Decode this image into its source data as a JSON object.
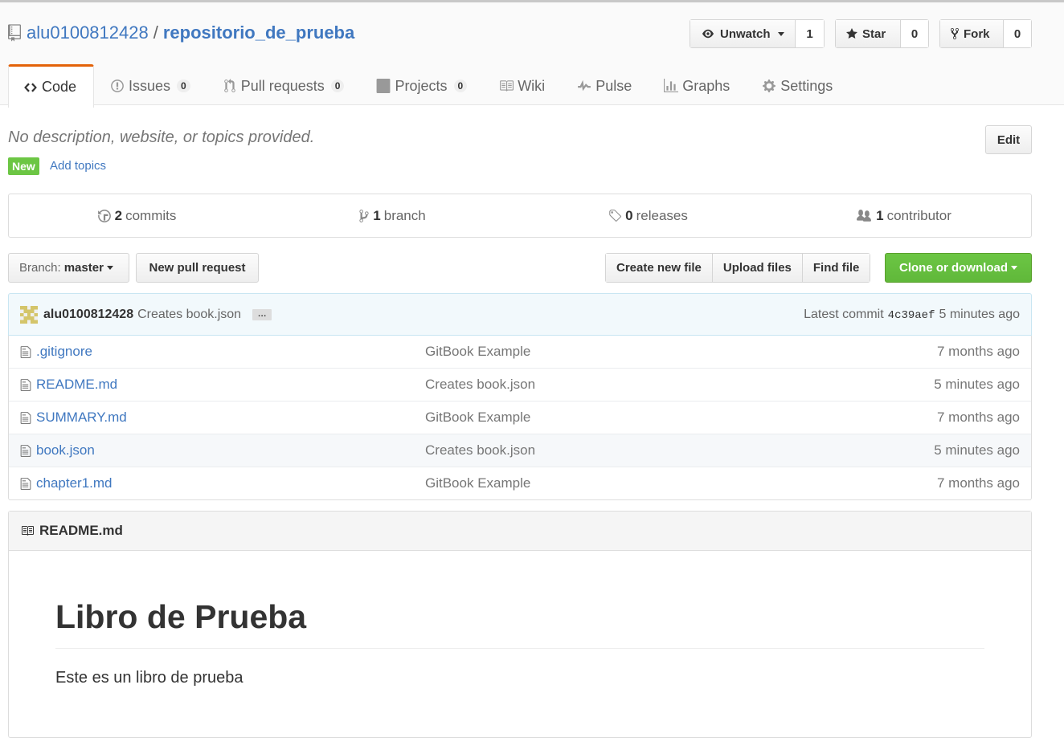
{
  "repo": {
    "owner": "alu0100812428",
    "separator": "/",
    "name": "repositorio_de_prueba"
  },
  "actions": {
    "watch": {
      "label": "Unwatch",
      "count": "1"
    },
    "star": {
      "label": "Star",
      "count": "0"
    },
    "fork": {
      "label": "Fork",
      "count": "0"
    }
  },
  "nav": {
    "code": "Code",
    "issues": {
      "label": "Issues",
      "count": "0"
    },
    "pulls": {
      "label": "Pull requests",
      "count": "0"
    },
    "projects": {
      "label": "Projects",
      "count": "0"
    },
    "wiki": "Wiki",
    "pulse": "Pulse",
    "graphs": "Graphs",
    "settings": "Settings"
  },
  "description": {
    "text": "No description, website, or topics provided.",
    "new_label": "New",
    "add_topics": "Add topics",
    "edit": "Edit"
  },
  "summary": {
    "commits": {
      "count": "2",
      "label": "commits"
    },
    "branches": {
      "count": "1",
      "label": "branch"
    },
    "releases": {
      "count": "0",
      "label": "releases"
    },
    "contributors": {
      "count": "1",
      "label": "contributor"
    }
  },
  "filenav": {
    "branch_prefix": "Branch:",
    "branch_name": "master",
    "new_pull_request": "New pull request",
    "create_new_file": "Create new file",
    "upload_files": "Upload files",
    "find_file": "Find file",
    "clone_or_download": "Clone or download"
  },
  "latest_commit": {
    "author": "alu0100812428",
    "message": "Creates book.json",
    "ellipsis": "…",
    "prefix": "Latest commit",
    "sha": "4c39aef",
    "age": "5 minutes ago"
  },
  "files": [
    {
      "name": ".gitignore",
      "message": "GitBook Example",
      "age": "7 months ago"
    },
    {
      "name": "README.md",
      "message": "Creates book.json",
      "age": "5 minutes ago"
    },
    {
      "name": "SUMMARY.md",
      "message": "GitBook Example",
      "age": "7 months ago"
    },
    {
      "name": "book.json",
      "message": "Creates book.json",
      "age": "5 minutes ago"
    },
    {
      "name": "chapter1.md",
      "message": "GitBook Example",
      "age": "7 months ago"
    }
  ],
  "readme": {
    "filename": "README.md",
    "heading": "Libro de Prueba",
    "paragraph": "Este es un libro de prueba"
  },
  "colors": {
    "link": "#4078c0",
    "selected_tab_accent": "#e36209",
    "green_button": "#6cc644",
    "commit_tease_bg": "#f2f9fc"
  }
}
